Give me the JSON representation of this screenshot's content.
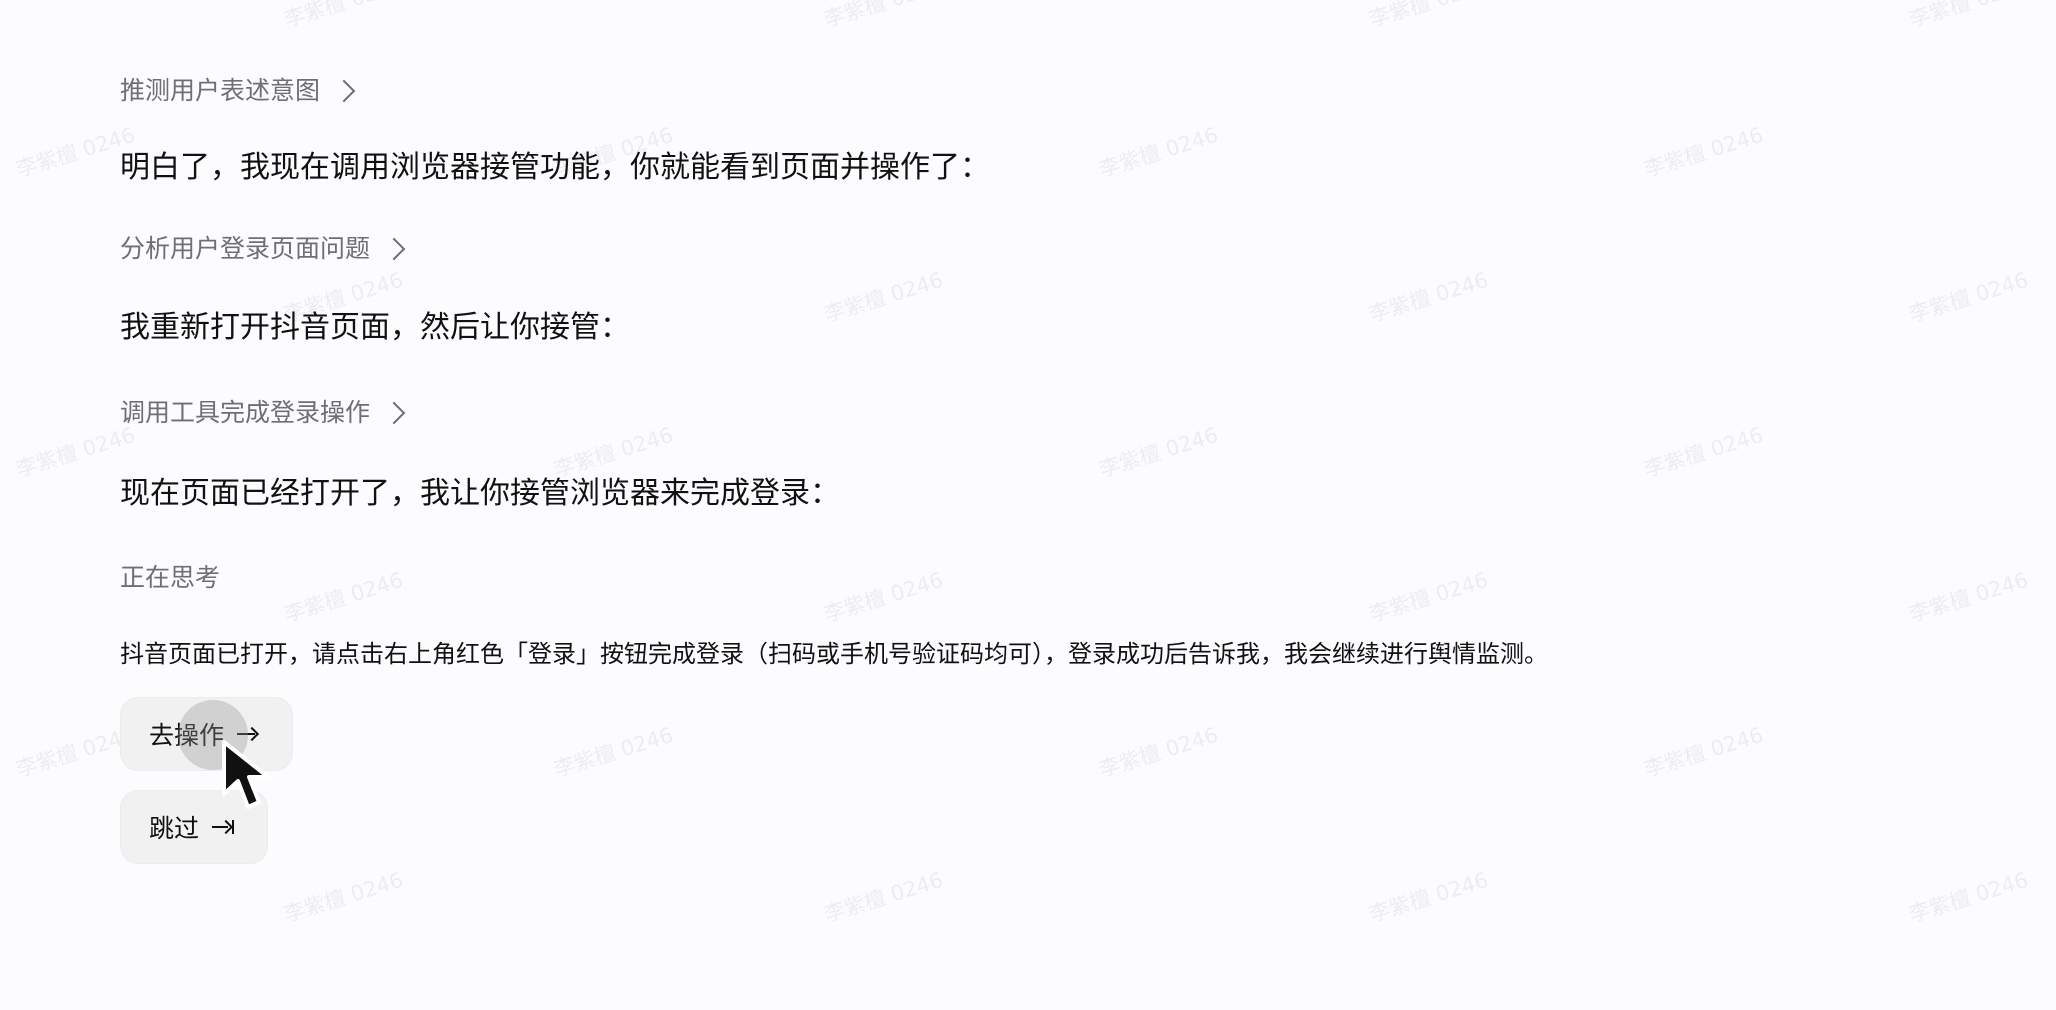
{
  "steps": [
    {
      "label": "推测用户表述意图"
    },
    {
      "label": "分析用户登录页面问题"
    },
    {
      "label": "调用工具完成登录操作"
    }
  ],
  "messages": [
    "明白了，我现在调用浏览器接管功能，你就能看到页面并操作了：",
    "我重新打开抖音页面，然后让你接管：",
    "现在页面已经打开了，我让你接管浏览器来完成登录："
  ],
  "thinking": "正在思考",
  "instruction": "抖音页面已打开，请点击右上角红色「登录」按钮完成登录（扫码或手机号验证码均可），登录成功后告诉我，我会继续进行舆情监测。",
  "actions": {
    "primary": {
      "label": "去操作",
      "icon": "arrow-right-icon"
    },
    "secondary": {
      "label": "跳过",
      "icon": "skip-arrow-icon"
    }
  },
  "watermark": "李紫檀 0246",
  "colors": {
    "background": "#fcfcfe",
    "text": "#111111",
    "muted": "#6f6f73",
    "button_bg": "#f1f1f2",
    "watermark": "#a0a0aa"
  }
}
